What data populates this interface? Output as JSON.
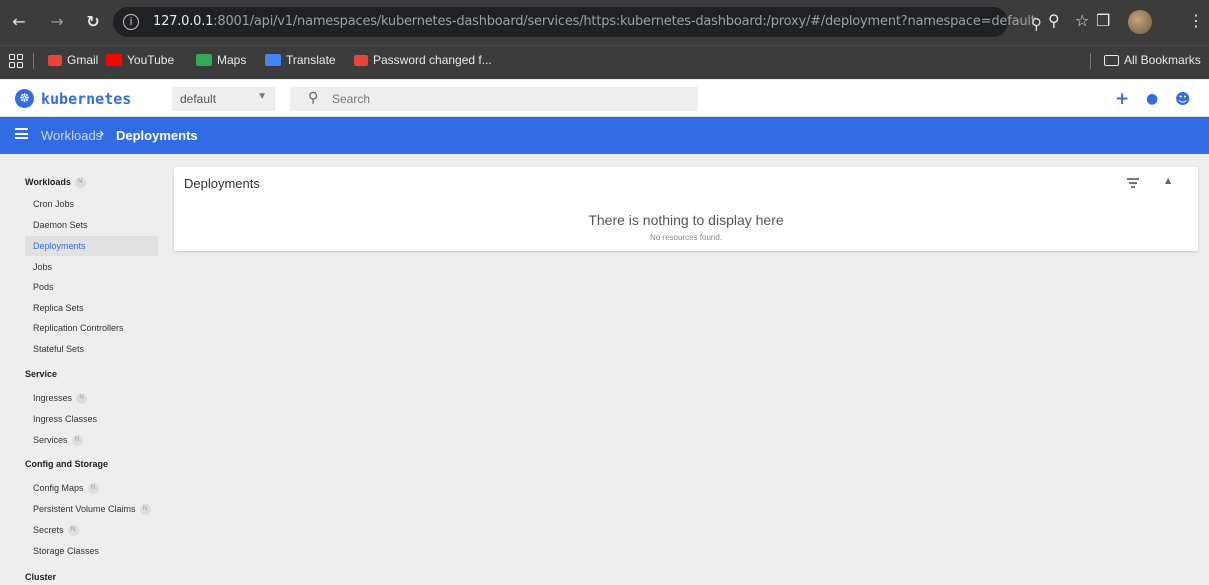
{
  "browser": {
    "url_host": "127.0.0.1",
    "url_rest": ":8001/api/v1/namespaces/kubernetes-dashboard/services/https:kubernetes-dashboard:/proxy/#/deployment?namespace=default",
    "bookmarks": [
      {
        "label": "Gmail",
        "icon": "gmail-icon",
        "color": "#ea4335"
      },
      {
        "label": "YouTube",
        "icon": "youtube-icon",
        "color": "#ff0000"
      },
      {
        "label": "Maps",
        "icon": "maps-icon",
        "color": "#34a853"
      },
      {
        "label": "Translate",
        "icon": "translate-icon",
        "color": "#4285f4"
      },
      {
        "label": "Password changed f...",
        "icon": "gmail-icon",
        "color": "#ea4335"
      }
    ],
    "all_bookmarks_label": "All Bookmarks"
  },
  "header": {
    "brand": "kubernetes",
    "namespace": "default",
    "search_placeholder": "Search"
  },
  "breadcrumb": {
    "parent": "Workloads",
    "current": "Deployments"
  },
  "sidebar": {
    "workloads_title": "Workloads",
    "workloads": [
      "Cron Jobs",
      "Daemon Sets",
      "Deployments",
      "Jobs",
      "Pods",
      "Replica Sets",
      "Replication Controllers",
      "Stateful Sets"
    ],
    "service_title": "Service",
    "service": [
      "Ingresses",
      "Ingress Classes",
      "Services"
    ],
    "config_title": "Config and Storage",
    "config": [
      "Config Maps",
      "Persistent Volume Claims",
      "Secrets",
      "Storage Classes"
    ],
    "cluster_title": "Cluster",
    "namespaced_badge": "N"
  },
  "main": {
    "card_title": "Deployments",
    "empty_title": "There is nothing to display here",
    "empty_subtitle": "No resources found."
  },
  "colors": {
    "accent": "#326ce5",
    "chrome": "#3c3c3c"
  }
}
